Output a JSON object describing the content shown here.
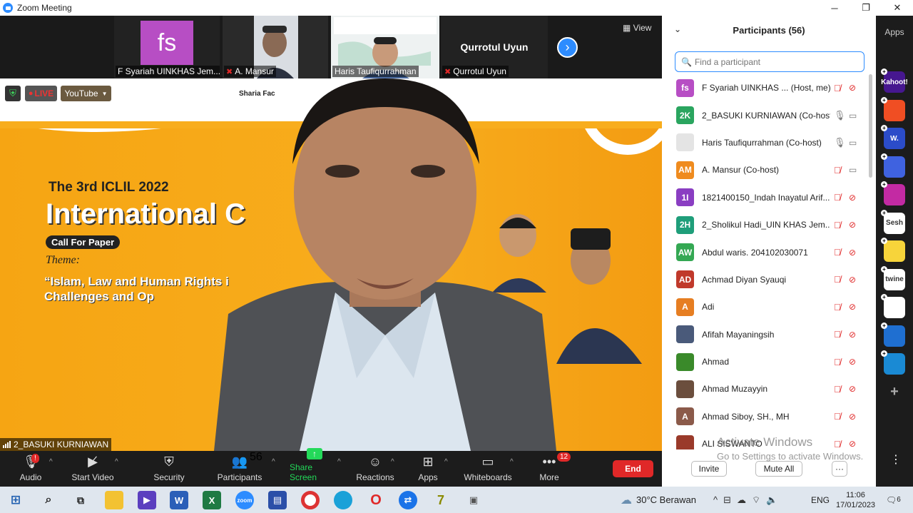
{
  "window": {
    "title": "Zoom Meeting"
  },
  "window_controls": {
    "minimize": "─",
    "maximize": "❐",
    "close": "✕"
  },
  "strip": {
    "view_label": "View",
    "thumbs": [
      {
        "name": "F Syariah UINKHAS Jem...",
        "initials": "fs"
      },
      {
        "name": "A. Mansur"
      },
      {
        "name": "Haris Taufiqurrahman"
      },
      {
        "name": "Qurrotul Uyun",
        "big_name": "Qurrotul Uyun"
      }
    ]
  },
  "video": {
    "live_label": "LIVE",
    "youtube_label": "YouTube",
    "sharia_text": "Sharia Fac",
    "title_small": "The 3rd ICLIL 2022",
    "title_big": "International C",
    "call_for_paper": "Call For Paper",
    "theme_label": "Theme:",
    "theme_line1": "“Islam, Law and Human Rights i",
    "theme_line2": "Challenges and Op",
    "speaker_name": "2_BASUKI KURNIAWAN"
  },
  "toolbar": {
    "audio": "Audio",
    "start_video": "Start Video",
    "security": "Security",
    "participants": "Participants",
    "participants_count": "56",
    "share_screen": "Share Screen",
    "reactions": "Reactions",
    "apps": "Apps",
    "whiteboards": "Whiteboards",
    "more": "More",
    "more_badge": "12",
    "audio_badge": "!",
    "end": "End"
  },
  "panel": {
    "title": "Participants (56)",
    "search_placeholder": "Find a participant",
    "participants": [
      {
        "initials": "fs",
        "name": "F Syariah UINKHAS ... (Host, me)",
        "color": "#b74ec4",
        "mic": "off",
        "cam": "off"
      },
      {
        "initials": "2K",
        "name": "2_BASUKI KURNIAWAN (Co-host)",
        "color": "#2aa55f",
        "mic": "on",
        "cam": "on"
      },
      {
        "initials": "",
        "name": "Haris Taufiqurrahman (Co-host)",
        "color": "#e4e4e4",
        "mic": "on",
        "cam": "on"
      },
      {
        "initials": "AM",
        "name": "A. Mansur (Co-host)",
        "color": "#ef8b1e",
        "mic": "off",
        "cam": "on"
      },
      {
        "initials": "1I",
        "name": "1821400150_Indah Inayatul Arif...",
        "color": "#8a3ec2",
        "mic": "off",
        "cam": "off"
      },
      {
        "initials": "2H",
        "name": "2_Sholikul Hadi_UIN KHAS Jem...",
        "color": "#1f9e7a",
        "mic": "off",
        "cam": "off"
      },
      {
        "initials": "AW",
        "name": "Abdul waris. 204102030071",
        "color": "#34a853",
        "mic": "off",
        "cam": "off"
      },
      {
        "initials": "AD",
        "name": "Achmad Diyan Syauqi",
        "color": "#c0392b",
        "mic": "off",
        "cam": "off"
      },
      {
        "initials": "A",
        "name": "Adi",
        "color": "#e67e22",
        "mic": "off",
        "cam": "off"
      },
      {
        "initials": "",
        "name": "Afifah Mayaningsih",
        "color": "#4a5a7a",
        "mic": "off",
        "cam": "off"
      },
      {
        "initials": "",
        "name": "Ahmad",
        "color": "#3a8a2a",
        "mic": "off",
        "cam": "off"
      },
      {
        "initials": "",
        "name": "Ahmad Muzayyin",
        "color": "#6b4e3d",
        "mic": "off",
        "cam": "off"
      },
      {
        "initials": "A",
        "name": "Ahmad Siboy, SH., MH",
        "color": "#8b5a4a",
        "mic": "off",
        "cam": "off"
      },
      {
        "initials": "",
        "name": "ALI SISWANTO",
        "color": "#9a3a2a",
        "mic": "off",
        "cam": "off"
      }
    ],
    "invite": "Invite",
    "mute_all": "Mute All",
    "more": "···"
  },
  "watermark": {
    "line1": "Activate Windows",
    "line2": "Go to Settings to activate Windows."
  },
  "apps_bar": {
    "label": "Apps",
    "apps": [
      {
        "label": "Kahoot!",
        "color": "#46178f"
      },
      {
        "label": "",
        "color": "#f04e23"
      },
      {
        "label": "W.",
        "color": "#2b4cc9"
      },
      {
        "label": "",
        "color": "#3f62e0"
      },
      {
        "label": "",
        "color": "#c32aa3"
      },
      {
        "label": "Sesh",
        "color": "#ffffff"
      },
      {
        "label": "",
        "color": "#f7d43a"
      },
      {
        "label": "twine",
        "color": "#ffffff"
      },
      {
        "label": "",
        "color": "#ffffff"
      },
      {
        "label": "",
        "color": "#1f6fd1"
      },
      {
        "label": "",
        "color": "#1a8ad4"
      }
    ]
  },
  "taskbar": {
    "weather": "30°C  Berawan",
    "lang": "ENG",
    "time": "11:06",
    "date": "17/01/2023",
    "notif_count": "6"
  },
  "colors": {
    "accent": "#2d8cff",
    "end": "#e02828",
    "share": "#23d959"
  }
}
